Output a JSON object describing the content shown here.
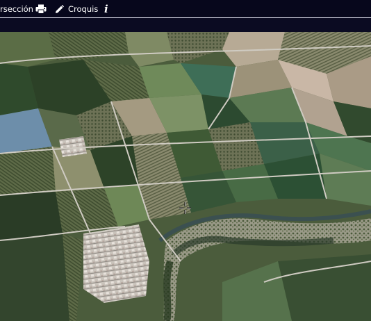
{
  "toolbar": {
    "interseccion_label": "rsección",
    "croquis_label": "Croquis",
    "icons": {
      "print": "print-icon",
      "croquis": "pencil-icon",
      "info": "info-icon"
    }
  },
  "map": {
    "kind": "satellite-orthophoto",
    "features": [
      "agricultural-fields",
      "town",
      "river",
      "roads"
    ]
  },
  "colors": {
    "toolbar_bg": "#07071c",
    "toolbar_text": "#ffffff",
    "separator": "#d9d9e6"
  }
}
